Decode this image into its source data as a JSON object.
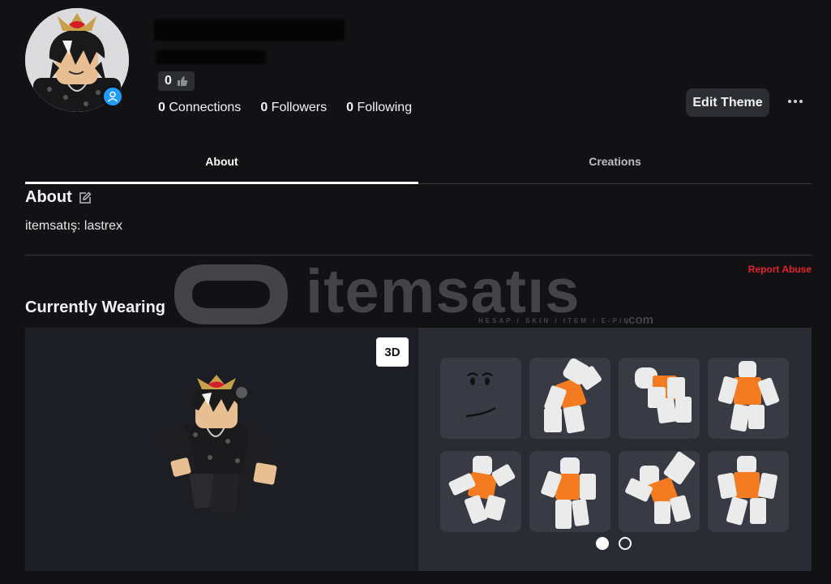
{
  "profile": {
    "likes_count": "0",
    "connections_count": "0",
    "connections_label": "Connections",
    "followers_count": "0",
    "followers_label": "Followers",
    "following_count": "0",
    "following_label": "Following",
    "edit_theme_label": "Edit Theme"
  },
  "tabs": [
    {
      "label": "About",
      "active": true
    },
    {
      "label": "Creations",
      "active": false
    }
  ],
  "about": {
    "title": "About",
    "text": "itemsatış: lastrex",
    "report_label": "Report Abuse"
  },
  "watermark": {
    "text": "itemsatıs",
    "subtitle": "HESAP / SKIN / ITEM / E-PIN",
    "suffix": ".com"
  },
  "wearing": {
    "title": "Currently Wearing",
    "view_toggle_label": "3D",
    "items": [
      {
        "icon": "face-icon"
      },
      {
        "icon": "animation-icon"
      },
      {
        "icon": "animation-icon"
      },
      {
        "icon": "animation-icon"
      },
      {
        "icon": "animation-icon"
      },
      {
        "icon": "animation-icon"
      },
      {
        "icon": "animation-icon"
      },
      {
        "icon": "animation-icon"
      }
    ],
    "pagination": {
      "pages": 2,
      "current": 1
    }
  },
  "colors": {
    "background": "#121215",
    "accent_report": "#e5202b",
    "badge_blue": "#1e9cff",
    "panel": "#2a2c33"
  }
}
